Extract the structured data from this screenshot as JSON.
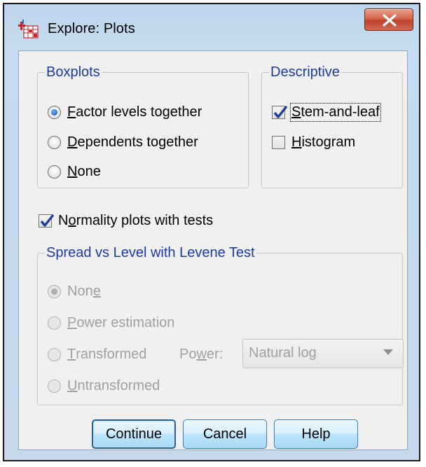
{
  "window": {
    "title": "Explore: Plots"
  },
  "boxplots": {
    "legend": "Boxplots",
    "options": [
      {
        "prefix": "",
        "mnemonic": "F",
        "rest": "actor levels together",
        "selected": true
      },
      {
        "prefix": "",
        "mnemonic": "D",
        "rest": "ependents together",
        "selected": false
      },
      {
        "prefix": "",
        "mnemonic": "N",
        "rest": "one",
        "selected": false
      }
    ]
  },
  "descriptive": {
    "legend": "Descriptive",
    "options": [
      {
        "mnemonic": "S",
        "rest": "tem-and-leaf",
        "checked": true
      },
      {
        "mnemonic": "H",
        "rest": "istogram",
        "checked": false
      }
    ]
  },
  "normality": {
    "prefix": "N",
    "mnemonic": "o",
    "rest": "rmality plots with tests",
    "checked": true
  },
  "spread": {
    "legend": "Spread vs Level with Levene Test",
    "options": [
      {
        "prefix": "Non",
        "mnemonic": "e",
        "rest": "",
        "selected": true
      },
      {
        "prefix": "",
        "mnemonic": "P",
        "rest": "ower estimation",
        "selected": false
      },
      {
        "prefix": "",
        "mnemonic": "T",
        "rest": "ransformed",
        "selected": false
      },
      {
        "prefix": "",
        "mnemonic": "U",
        "rest": "ntransformed",
        "selected": false
      }
    ],
    "power_label_prefix": "Po",
    "power_label_mnemonic": "w",
    "power_label_rest": "er:",
    "power_value": "Natural log"
  },
  "buttons": {
    "continue": "Continue",
    "cancel": "Cancel",
    "help": "Help"
  },
  "colors": {
    "legend": "#1c3aa8",
    "disabled_text": "#a0a0a0",
    "close_button": "#c0432a"
  }
}
